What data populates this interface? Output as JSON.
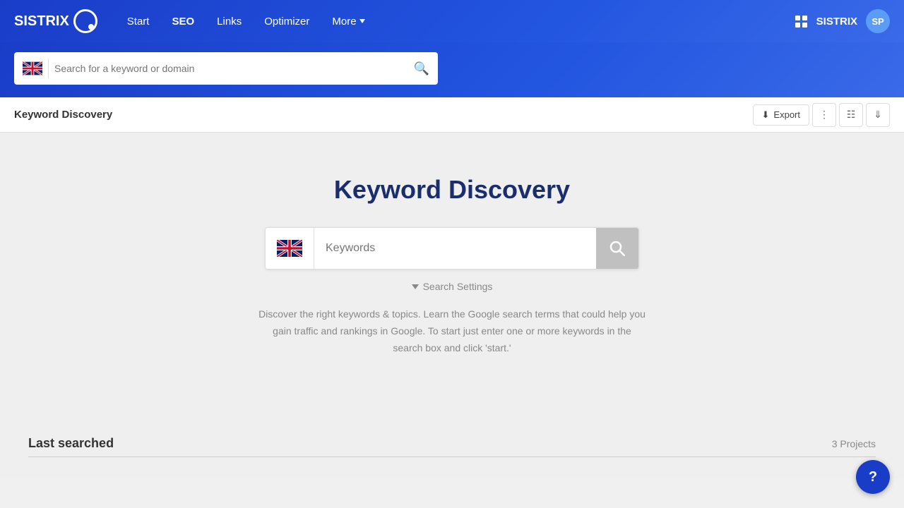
{
  "header": {
    "logo_text": "SISTRIX",
    "nav": {
      "items": [
        {
          "label": "Start",
          "active": false
        },
        {
          "label": "SEO",
          "active": true
        },
        {
          "label": "Links",
          "active": false
        },
        {
          "label": "Optimizer",
          "active": false
        },
        {
          "label": "More",
          "active": false
        }
      ]
    },
    "brand_name": "SISTRIX",
    "avatar_initials": "SP"
  },
  "search_bar": {
    "placeholder": "Search for a keyword or domain"
  },
  "page_header": {
    "title": "Keyword Discovery",
    "export_label": "Export"
  },
  "main": {
    "title": "Keyword Discovery",
    "search_placeholder": "Keywords",
    "search_settings_label": "Search Settings",
    "description": "Discover the right keywords & topics. Learn the Google search terms that could help you gain traffic and rankings in Google. To start just enter one or more keywords in the search box and click 'start.'"
  },
  "last_searched": {
    "title": "Last searched",
    "projects_label": "3 Projects"
  },
  "help_btn_label": "?"
}
